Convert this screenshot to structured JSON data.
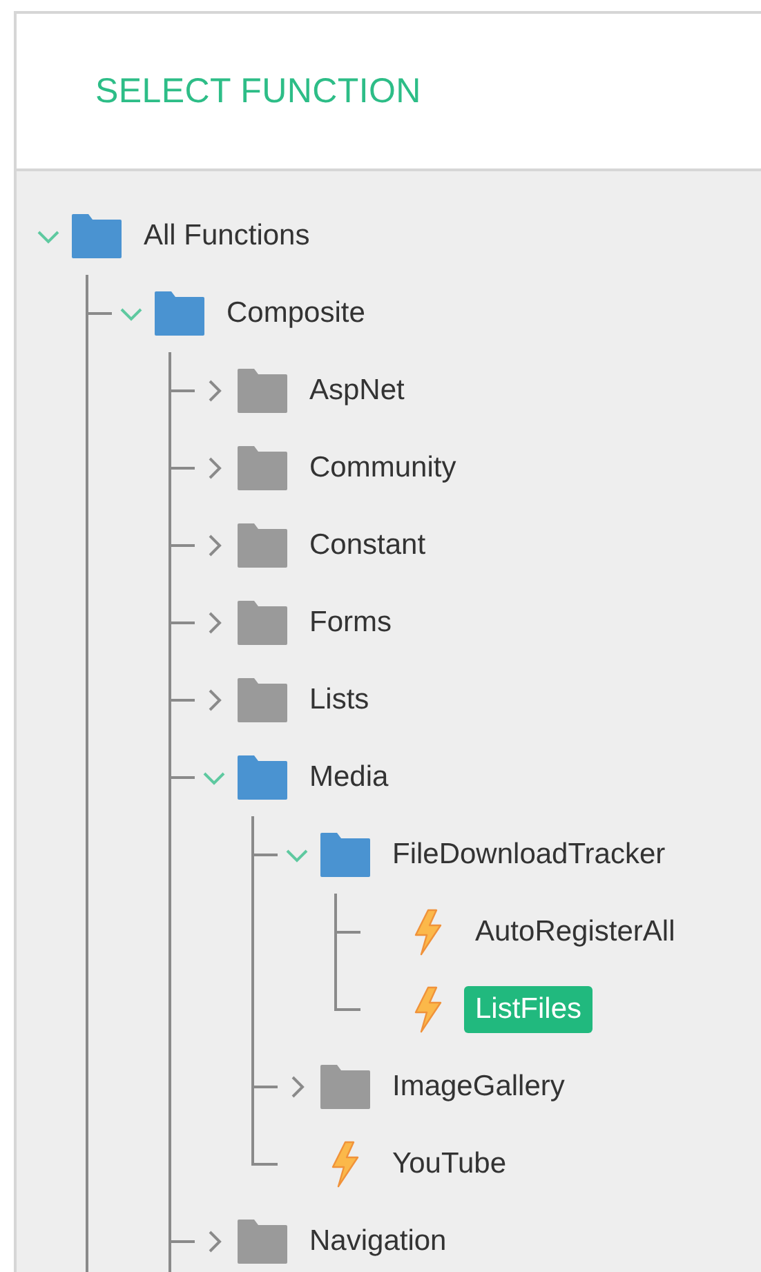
{
  "panel": {
    "title": "SELECT FUNCTION"
  },
  "tree": [
    {
      "label": "All Functions",
      "kind": "folder",
      "expanded": true,
      "selected": false,
      "more_below": true,
      "children": [
        {
          "label": "Composite",
          "kind": "folder",
          "expanded": true,
          "selected": false,
          "more_below": true,
          "children": [
            {
              "label": "AspNet",
              "kind": "folder",
              "expanded": false,
              "selected": false
            },
            {
              "label": "Community",
              "kind": "folder",
              "expanded": false,
              "selected": false
            },
            {
              "label": "Constant",
              "kind": "folder",
              "expanded": false,
              "selected": false
            },
            {
              "label": "Forms",
              "kind": "folder",
              "expanded": false,
              "selected": false
            },
            {
              "label": "Lists",
              "kind": "folder",
              "expanded": false,
              "selected": false
            },
            {
              "label": "Media",
              "kind": "folder",
              "expanded": true,
              "selected": false,
              "children": [
                {
                  "label": "FileDownloadTracker",
                  "kind": "folder",
                  "expanded": true,
                  "selected": false,
                  "children": [
                    {
                      "label": "AutoRegisterAll",
                      "kind": "function",
                      "selected": false
                    },
                    {
                      "label": "ListFiles",
                      "kind": "function",
                      "selected": true
                    }
                  ]
                },
                {
                  "label": "ImageGallery",
                  "kind": "folder",
                  "expanded": false,
                  "selected": false
                },
                {
                  "label": "YouTube",
                  "kind": "function",
                  "selected": false
                }
              ]
            },
            {
              "label": "Navigation",
              "kind": "folder",
              "expanded": false,
              "selected": false
            }
          ]
        }
      ]
    }
  ]
}
